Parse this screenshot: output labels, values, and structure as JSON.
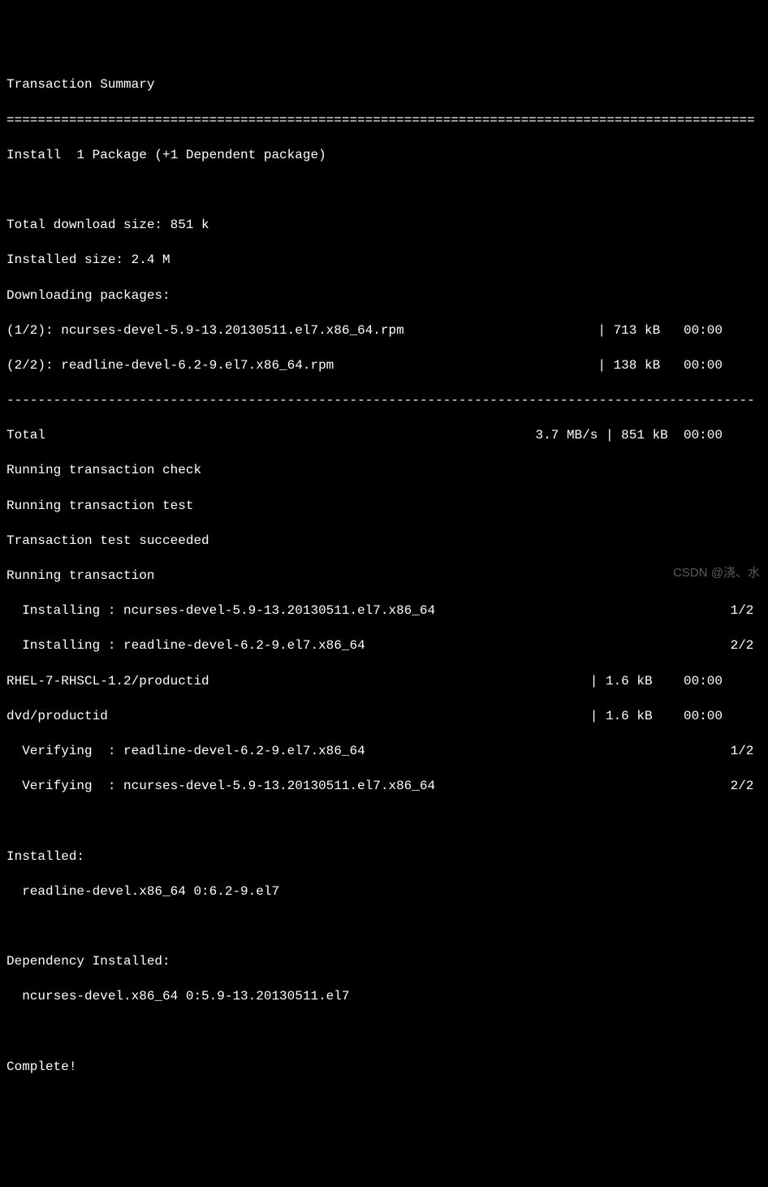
{
  "header": "Transaction Summary",
  "divider_eq": "================================================================================================",
  "divider_dash": "------------------------------------------------------------------------------------------------",
  "install_line": "Install  1 Package (+1 Dependent package)",
  "total_download": "Total download size: 851 k",
  "installed_size": "Installed size: 2.4 M",
  "downloading": "Downloading packages:",
  "downloads": [
    {
      "left": "(1/2): ncurses-devel-5.9-13.20130511.el7.x86_64.rpm",
      "right": "| 713 kB   00:00     "
    },
    {
      "left": "(2/2): readline-devel-6.2-9.el7.x86_64.rpm",
      "right": "| 138 kB   00:00     "
    }
  ],
  "total": {
    "left": "Total",
    "right": "3.7 MB/s | 851 kB  00:00     "
  },
  "running_check": "Running transaction check",
  "running_test": "Running transaction test",
  "test_succeeded": "Transaction test succeeded",
  "running_trans": "Running transaction",
  "installing": [
    {
      "left": "  Installing : ncurses-devel-5.9-13.20130511.el7.x86_64",
      "right": "1/2 "
    },
    {
      "left": "  Installing : readline-devel-6.2-9.el7.x86_64",
      "right": "2/2 "
    }
  ],
  "productid": [
    {
      "left": "RHEL-7-RHSCL-1.2/productid",
      "right": "| 1.6 kB    00:00     "
    },
    {
      "left": "dvd/productid",
      "right": "| 1.6 kB    00:00     "
    }
  ],
  "verifying": [
    {
      "left": "  Verifying  : readline-devel-6.2-9.el7.x86_64",
      "right": "1/2 "
    },
    {
      "left": "  Verifying  : ncurses-devel-5.9-13.20130511.el7.x86_64",
      "right": "2/2 "
    }
  ],
  "installed_header": "Installed:",
  "installed_pkg": "  readline-devel.x86_64 0:6.2-9.el7",
  "depinstalled_header": "Dependency Installed:",
  "depinstalled_pkg": "  ncurses-devel.x86_64 0:5.9-13.20130511.el7",
  "complete": "Complete!",
  "watermark": "CSDN @浇、水"
}
